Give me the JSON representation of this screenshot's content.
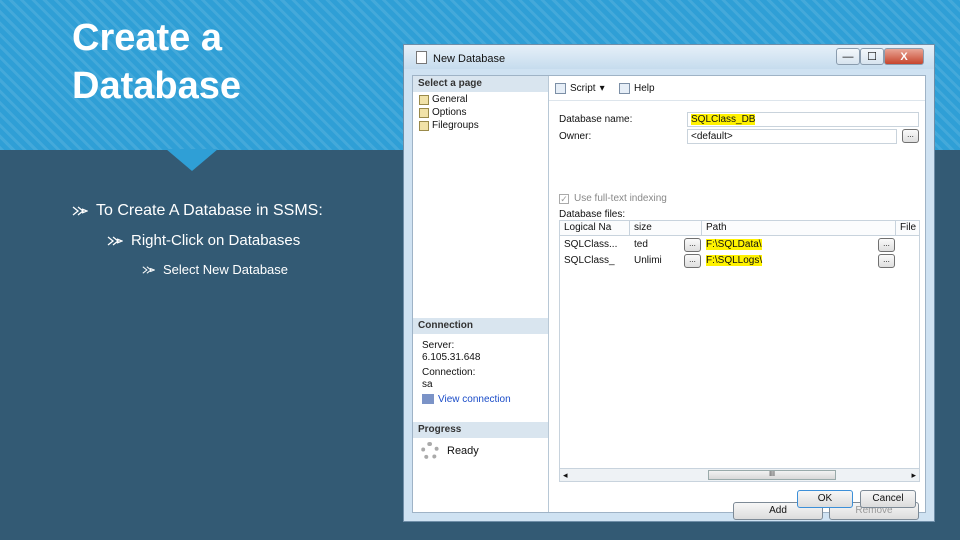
{
  "slide": {
    "title_line1": "Create a",
    "title_line2": "Database",
    "bullets": [
      "To Create A Database in SSMS:",
      "Right-Click on Databases",
      "Select New Database"
    ]
  },
  "dialog": {
    "title": "New Database",
    "window_controls": {
      "minimize": "—",
      "maximize": "☐",
      "close": "X"
    },
    "select_a_page": {
      "header": "Select a page",
      "pages": [
        "General",
        "Options",
        "Filegroups"
      ]
    },
    "connection": {
      "header": "Connection",
      "server_label": "Server:",
      "server_value": "6.105.31.648",
      "connection_label": "Connection:",
      "connection_value": "sa",
      "view_link": "View connection"
    },
    "progress": {
      "header": "Progress",
      "status": "Ready"
    },
    "toolbar": {
      "script": "Script",
      "script_arrow": "▾",
      "help": "Help"
    },
    "form": {
      "db_name_label": "Database name:",
      "db_name_value": "SQLClass_DB",
      "owner_label": "Owner:",
      "owner_value": "<default>",
      "owner_browse": "...",
      "fulltext_label": "Use full-text indexing",
      "fulltext_checked": true,
      "fulltext_mark": "✓",
      "files_label": "Database files:"
    },
    "files_table": {
      "columns": [
        "Logical Na",
        "size",
        "Path",
        "File Na"
      ],
      "rows": [
        {
          "name": "SQLClass...",
          "size": "ted",
          "path": "F:\\SQLData\\",
          "browse1": "...",
          "browse2": "..."
        },
        {
          "name": "SQLClass_",
          "size": "Unlimi",
          "path": "F:\\SQLLogs\\",
          "browse1": "...",
          "browse2": "..."
        }
      ]
    },
    "scrollbar": {
      "left": "◂",
      "thumb": "III",
      "right": "▸"
    },
    "buttons": {
      "add": "Add",
      "remove": "Remove",
      "ok": "OK",
      "cancel": "Cancel"
    },
    "colors": {
      "highlight": "#fff200",
      "link": "#1a4cc8",
      "banner": "#2f9fd6",
      "background": "#335a74"
    }
  }
}
